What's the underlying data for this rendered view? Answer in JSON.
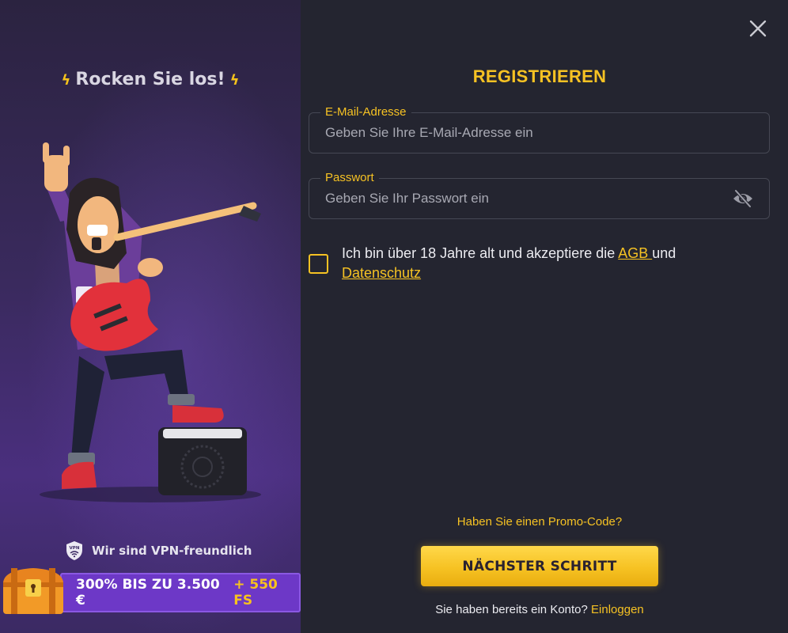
{
  "promo": {
    "tagline": "Rocken Sie los!",
    "vpn_text": "Wir sind VPN-freundlich",
    "vpn_badge": "VPN",
    "bonus_main": "300% BIS ZU 3.500 €",
    "bonus_extra": "+ 550 FS"
  },
  "form": {
    "title": "REGISTRIEREN",
    "email": {
      "label": "E-Mail-Adresse",
      "placeholder": "Geben Sie Ihre E-Mail-Adresse ein",
      "value": ""
    },
    "password": {
      "label": "Passwort",
      "placeholder": "Geben Sie Ihr Passwort ein",
      "value": ""
    },
    "consent": {
      "text_before": "Ich bin über 18 Jahre alt und akzeptiere die ",
      "terms_link": "AGB ",
      "text_middle": "und ",
      "privacy_link": "Datenschutz",
      "checked": false
    },
    "promo_code_link": "Haben Sie einen Promo-Code?",
    "next_button": "NÄCHSTER SCHRITT",
    "login_prompt": "Sie haben bereits ein Konto?",
    "login_link": "Einloggen"
  },
  "icons": {
    "close": "close-icon",
    "eye": "eye-off-icon",
    "shield": "vpn-shield-icon",
    "chest": "treasure-chest-icon",
    "bolt": "lightning-bolt-icon"
  },
  "colors": {
    "accent": "#f6c223",
    "background": "#242530",
    "bonus": "#6d38c7"
  }
}
